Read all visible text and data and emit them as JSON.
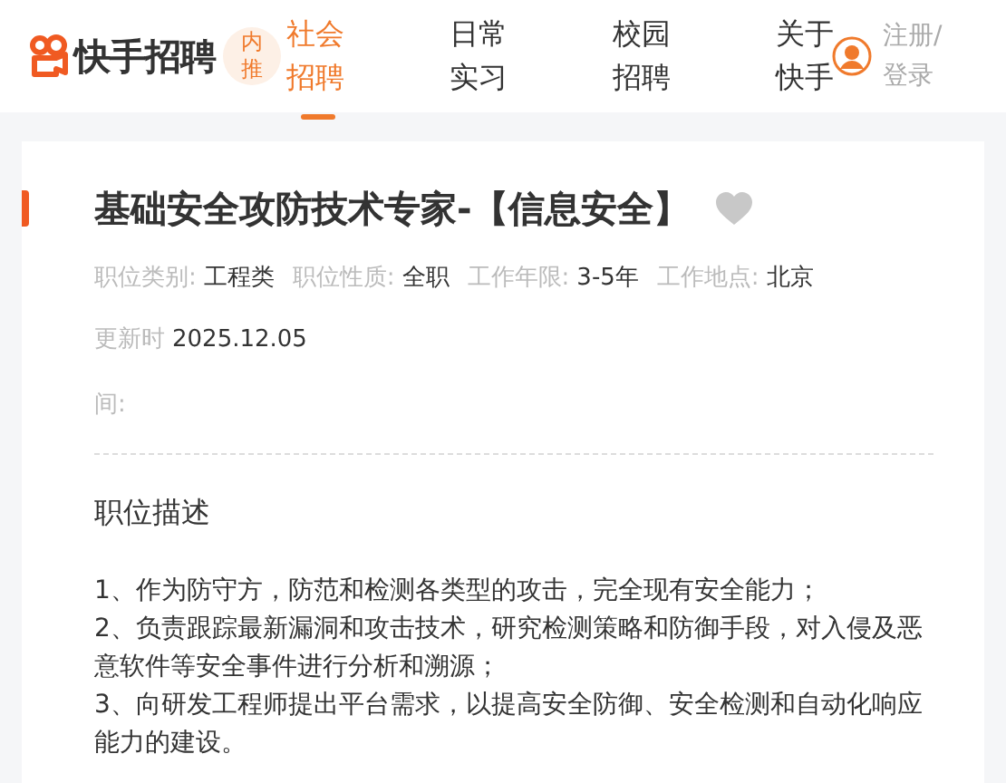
{
  "header": {
    "logo_text": "快手招聘",
    "badge": "内推",
    "nav": [
      {
        "label": "社会招聘",
        "selected": true
      },
      {
        "label": "日常实习",
        "selected": false
      },
      {
        "label": "校园招聘",
        "selected": false
      },
      {
        "label": "关于快手",
        "selected": false
      }
    ],
    "login": "注册/登录"
  },
  "job": {
    "title": "基础安全攻防技术专家-【信息安全】",
    "meta": [
      {
        "label": "职位类别:",
        "value": "工程类"
      },
      {
        "label": "职位性质:",
        "value": "全职"
      },
      {
        "label": "工作年限:",
        "value": "3-5年"
      },
      {
        "label": "工作地点:",
        "value": "北京"
      }
    ],
    "updated_label": "更新时",
    "updated_value": "2025.12.05",
    "cut_label": "间:",
    "section_title": "职位描述",
    "lines": [
      "1、作为防守方，防范和检测各类型的攻击，完全现有安全能力；",
      "2、负责跟踪最新漏洞和攻击技术，研究检测策略和防御手段，对入侵及恶意软件等安全事件进行分析和溯源；",
      "3、向研发工程师提出平台需求，以提高安全防御、安全检测和自动化响应能力的建设。"
    ]
  }
}
